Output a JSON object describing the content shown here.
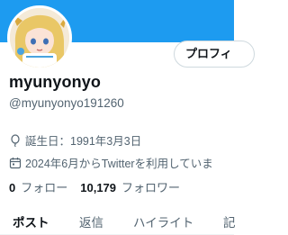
{
  "profile": {
    "edit_button": "プロフィ",
    "display_name": "myunyonyo",
    "handle": "@myunyonyo191260",
    "birthday": "誕生日：1991年3月3日",
    "joined": "2024年6月からTwitterを利用していま",
    "following_count": "0",
    "following_label": "フォロー",
    "followers_count": "10,179",
    "followers_label": "フォロワー"
  },
  "tabs": [
    {
      "label": "ポスト"
    },
    {
      "label": "返信"
    },
    {
      "label": "ハイライト"
    },
    {
      "label": "記"
    }
  ],
  "icons": {
    "birthday": "balloon-icon",
    "joined": "calendar-icon"
  },
  "colors": {
    "banner": "#1d9bf0",
    "text_primary": "#0f1419",
    "text_secondary": "#536471",
    "border": "#cfd9de"
  }
}
